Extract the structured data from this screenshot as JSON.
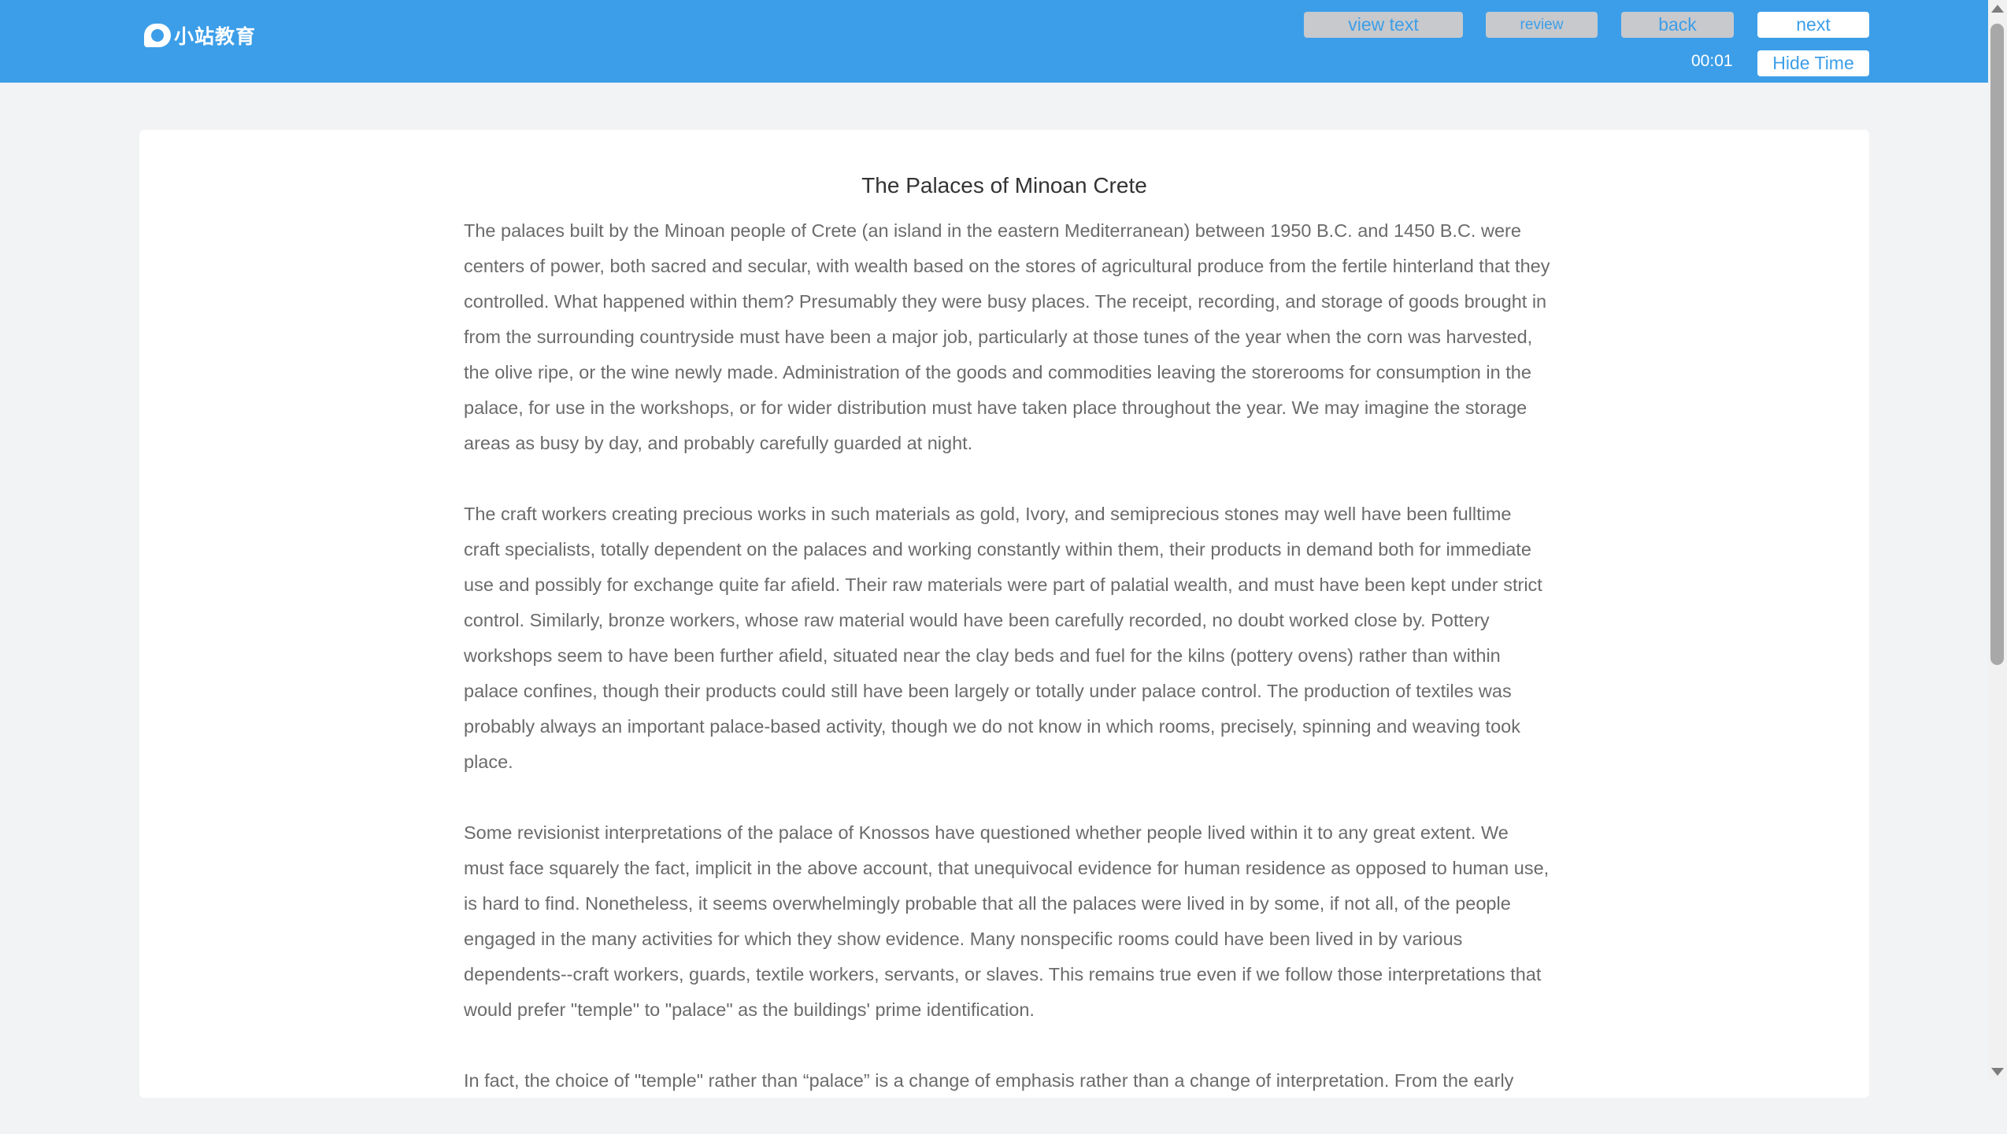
{
  "header": {
    "logo_text": "小站教育",
    "view_text_label": "view text",
    "review_label": "review",
    "back_label": "back",
    "next_label": "next",
    "timer": "00:01",
    "hide_time_label": "Hide Time"
  },
  "passage": {
    "title": "The Palaces of Minoan Crete",
    "paragraphs": [
      "The palaces built by the Minoan people of Crete (an island in the eastern Mediterranean) between 1950 B.C. and 1450 B.C. were centers of power, both sacred and secular, with wealth based on the stores of agricultural produce from the fertile hinterland that they controlled. What happened within them? Presumably they were busy places. The receipt, recording, and storage of goods brought in from the surrounding countryside must have been a major job, particularly at those tunes of the year when the corn was harvested, the olive ripe, or the wine newly made. Administration of the goods and commodities leaving the storerooms for consumption in the palace, for use in the workshops, or for wider distribution must have taken place throughout the year. We may imagine the storage areas as busy by day, and probably carefully guarded at night.",
      "The craft workers creating precious works in such materials as gold, Ivory, and semiprecious stones may well have been fulltime craft specialists, totally dependent on the palaces and working constantly within them, their products in demand both for immediate use and possibly for exchange quite far afield. Their raw materials were part of palatial wealth, and must have been kept under strict control. Similarly, bronze workers, whose raw material would have been carefully recorded, no doubt worked close by. Pottery workshops seem to have been further afield, situated near the clay beds and fuel for the kilns (pottery ovens) rather than within palace confines, though their products could still have been largely or totally under palace control. The production of textiles was probably always an important palace-based activity, though we do not know in which rooms, precisely, spinning and weaving took place.",
      "Some revisionist interpretations of the palace of Knossos have questioned whether people lived within it to any great extent. We must face squarely the fact, implicit in the above account, that unequivocal evidence for human residence as opposed to human use, is hard to find. Nonetheless, it seems overwhelmingly probable that all the palaces were lived in by some, if not all, of the people engaged in the many activities for which they show evidence. Many nonspecific rooms could have been lived in by various dependents--craft workers, guards, textile workers, servants, or slaves. This remains true even if we follow those interpretations that would prefer \"temple\" to \"palace\" as the buildings' prime identification.",
      "In fact, the choice of \"temple\" rather than “palace” is a change of emphasis rather than a change of interpretation. From the early"
    ]
  }
}
